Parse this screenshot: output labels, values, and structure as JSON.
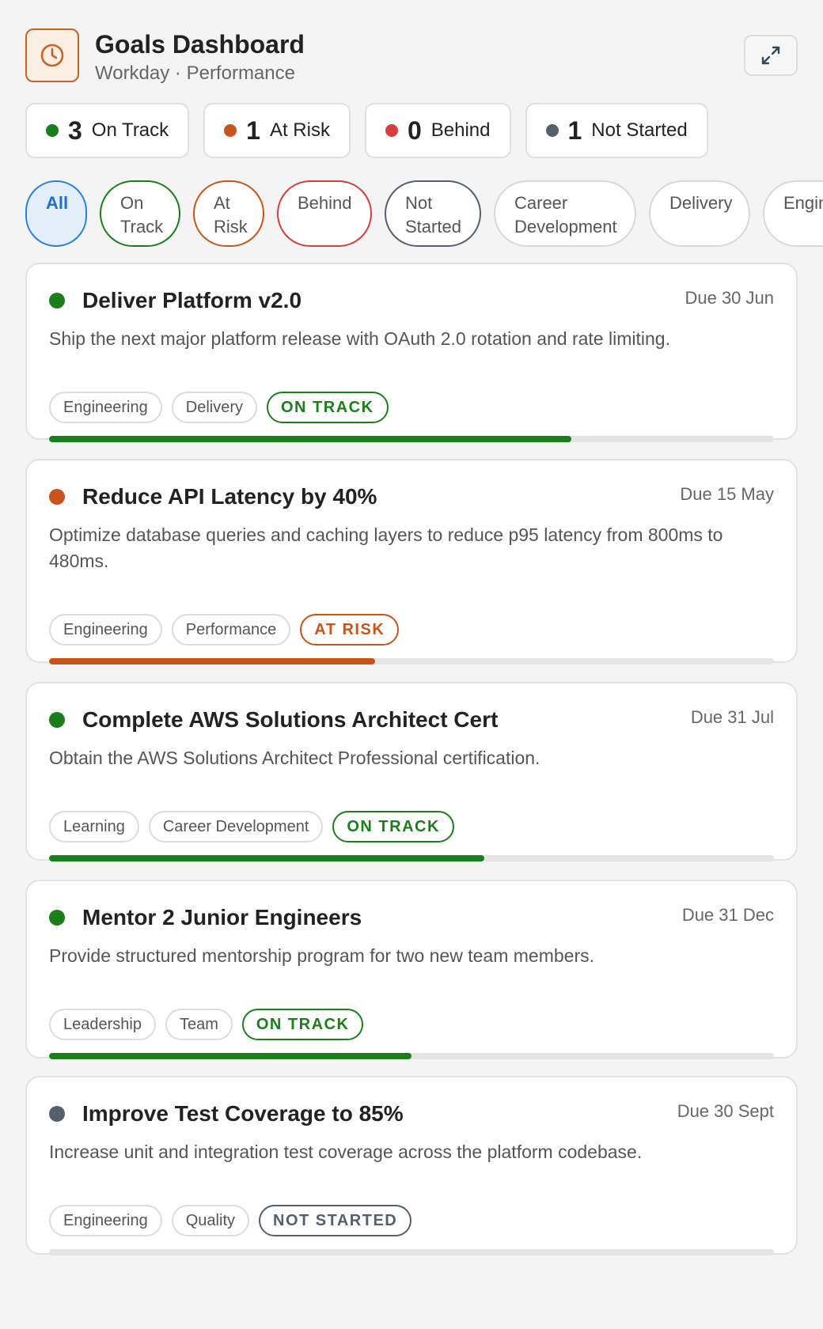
{
  "header": {
    "title": "Goals Dashboard",
    "subtitle": "Workday · Performance",
    "app_icon": "clock-icon",
    "expand_icon": "expand-icon"
  },
  "colors": {
    "on_track": "#1a7f1a",
    "at_risk": "#c8541a",
    "behind": "#d63d3d",
    "not_started": "#56606d",
    "accent": "#2b7de0",
    "brand": "#c8622a"
  },
  "summary": [
    {
      "key": "on_track",
      "count": "3",
      "label": "On Track"
    },
    {
      "key": "at_risk",
      "count": "1",
      "label": "At Risk"
    },
    {
      "key": "behind",
      "count": "0",
      "label": "Behind"
    },
    {
      "key": "not_started",
      "count": "1",
      "label": "Not Started"
    }
  ],
  "filters": [
    {
      "key": "all",
      "label": "All",
      "selected": true
    },
    {
      "key": "on-track",
      "label": "On Track"
    },
    {
      "key": "at-risk",
      "label": "At Risk"
    },
    {
      "key": "behind",
      "label": "Behind"
    },
    {
      "key": "not-started",
      "label": "Not Started"
    },
    {
      "key": "career",
      "label": "Career Development"
    },
    {
      "key": "delivery",
      "label": "Delivery"
    },
    {
      "key": "engineering",
      "label": "Engineering"
    }
  ],
  "goals": [
    {
      "title": "Deliver Platform v2.0",
      "due": "Due 30 Jun",
      "description": "Ship the next major platform release with OAuth 2.0 rotation and rate limiting.",
      "tags": [
        "Engineering",
        "Delivery"
      ],
      "status": "ON TRACK",
      "status_key": "on_track",
      "progress": 0.72
    },
    {
      "title": "Reduce API Latency by 40%",
      "due": "Due 15 May",
      "description": "Optimize database queries and caching layers to reduce p95 latency from 800ms to 480ms.",
      "tags": [
        "Engineering",
        "Performance"
      ],
      "status": "AT RISK",
      "status_key": "at_risk",
      "progress": 0.45
    },
    {
      "title": "Complete AWS Solutions Architect Cert",
      "due": "Due 31 Jul",
      "description": "Obtain the AWS Solutions Architect Professional certification.",
      "tags": [
        "Learning",
        "Career Development"
      ],
      "status": "ON TRACK",
      "status_key": "on_track",
      "progress": 0.6
    },
    {
      "title": "Mentor 2 Junior Engineers",
      "due": "Due 31 Dec",
      "description": "Provide structured mentorship program for two new team members.",
      "tags": [
        "Leadership",
        "Team"
      ],
      "status": "ON TRACK",
      "status_key": "on_track",
      "progress": 0.5
    },
    {
      "title": "Improve Test Coverage to 85%",
      "due": "Due 30 Sept",
      "description": "Increase unit and integration test coverage across the platform codebase.",
      "tags": [
        "Engineering",
        "Quality"
      ],
      "status": "NOT STARTED",
      "status_key": "not_started",
      "progress": 0
    }
  ]
}
